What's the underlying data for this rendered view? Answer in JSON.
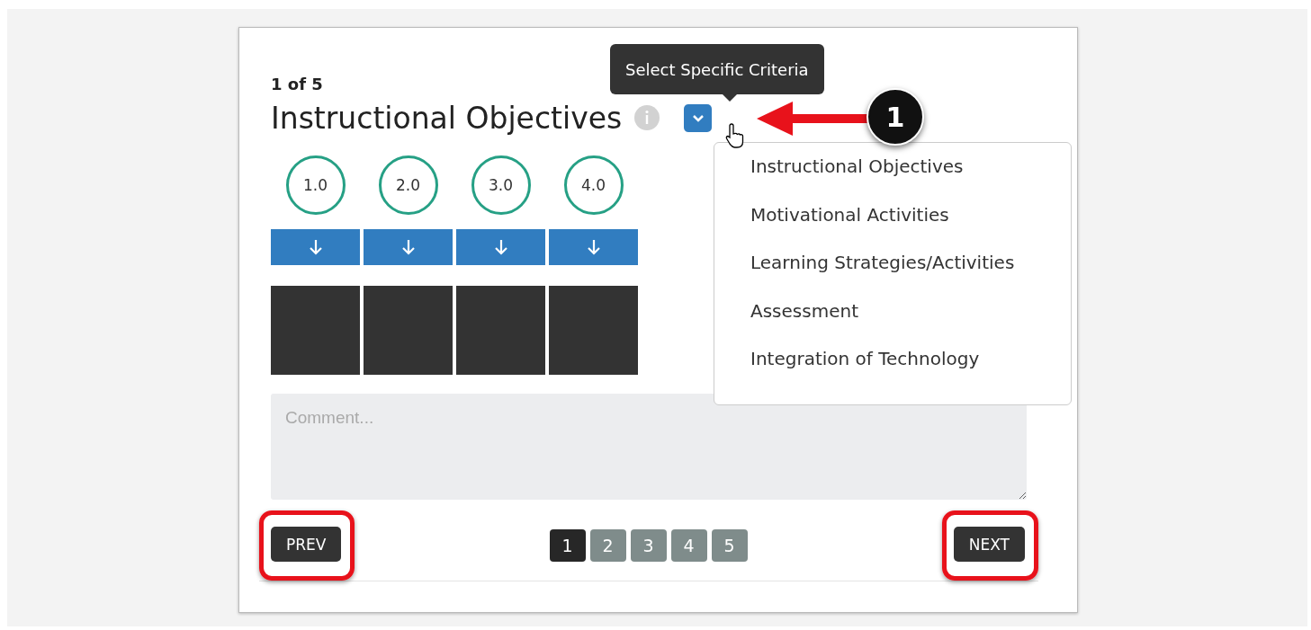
{
  "counter": "1 of 5",
  "title": "Instructional Objectives",
  "tooltip": "Select Specific Criteria",
  "criteria_menu": {
    "expanded": true,
    "items": [
      "Instructional Objectives",
      "Motivational Activities",
      "Learning Strategies/Activities",
      "Assessment",
      "Integration of Technology"
    ]
  },
  "ratings": [
    "1.0",
    "2.0",
    "3.0",
    "4.0"
  ],
  "comment": {
    "placeholder": "Comment..."
  },
  "prev_button": "PREV",
  "next_button": "NEXT",
  "pages": [
    {
      "label": "1",
      "selected": true
    },
    {
      "label": "2",
      "selected": false
    },
    {
      "label": "3",
      "selected": false
    },
    {
      "label": "4",
      "selected": false
    },
    {
      "label": "5",
      "selected": false
    }
  ],
  "callout": "1"
}
